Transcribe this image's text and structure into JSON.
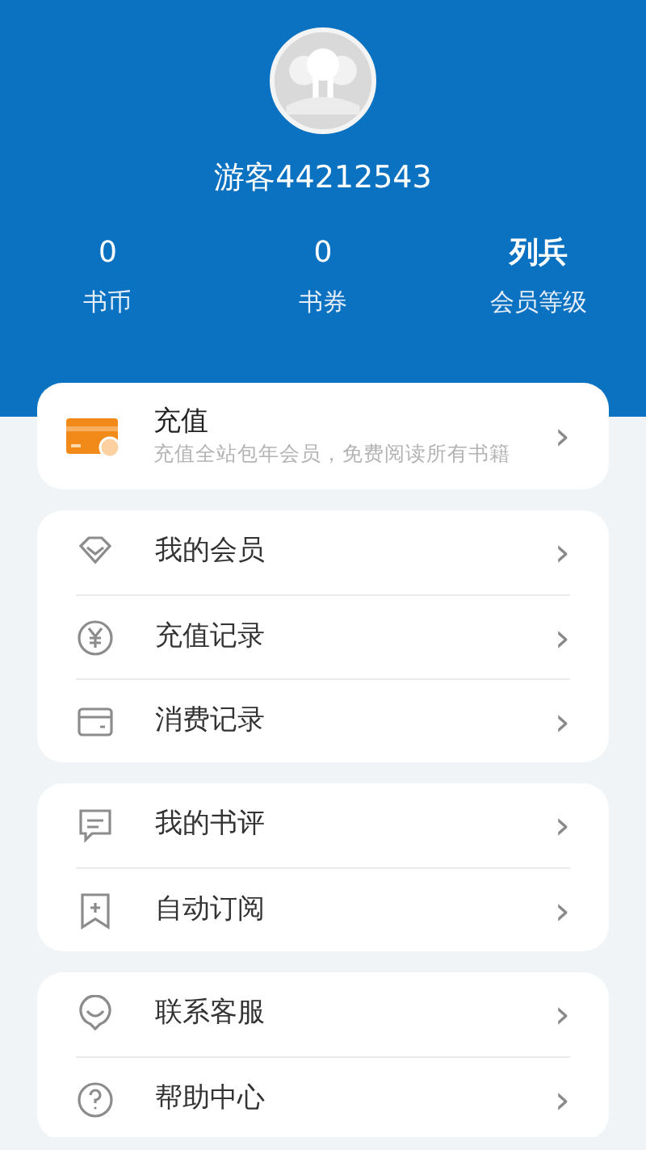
{
  "profile": {
    "username": "游客44212543"
  },
  "stats": [
    {
      "value": "0",
      "label": "书币",
      "emphasis": false
    },
    {
      "value": "0",
      "label": "书券",
      "emphasis": false
    },
    {
      "value": "列兵",
      "label": "会员等级",
      "emphasis": true
    }
  ],
  "recharge": {
    "title": "充值",
    "subtitle": "充值全站包年会员，免费阅读所有书籍",
    "chevron": "›"
  },
  "menu_groups": [
    {
      "items": [
        {
          "label": "我的会员",
          "chevron": "›"
        },
        {
          "label": "充值记录",
          "chevron": "›"
        },
        {
          "label": "消费记录",
          "chevron": "›"
        }
      ]
    },
    {
      "items": [
        {
          "label": "我的书评",
          "chevron": "›"
        },
        {
          "label": "自动订阅",
          "chevron": "›"
        }
      ]
    },
    {
      "items": [
        {
          "label": "联系客服",
          "chevron": "›"
        },
        {
          "label": "帮助中心",
          "chevron": "›"
        }
      ]
    }
  ]
}
